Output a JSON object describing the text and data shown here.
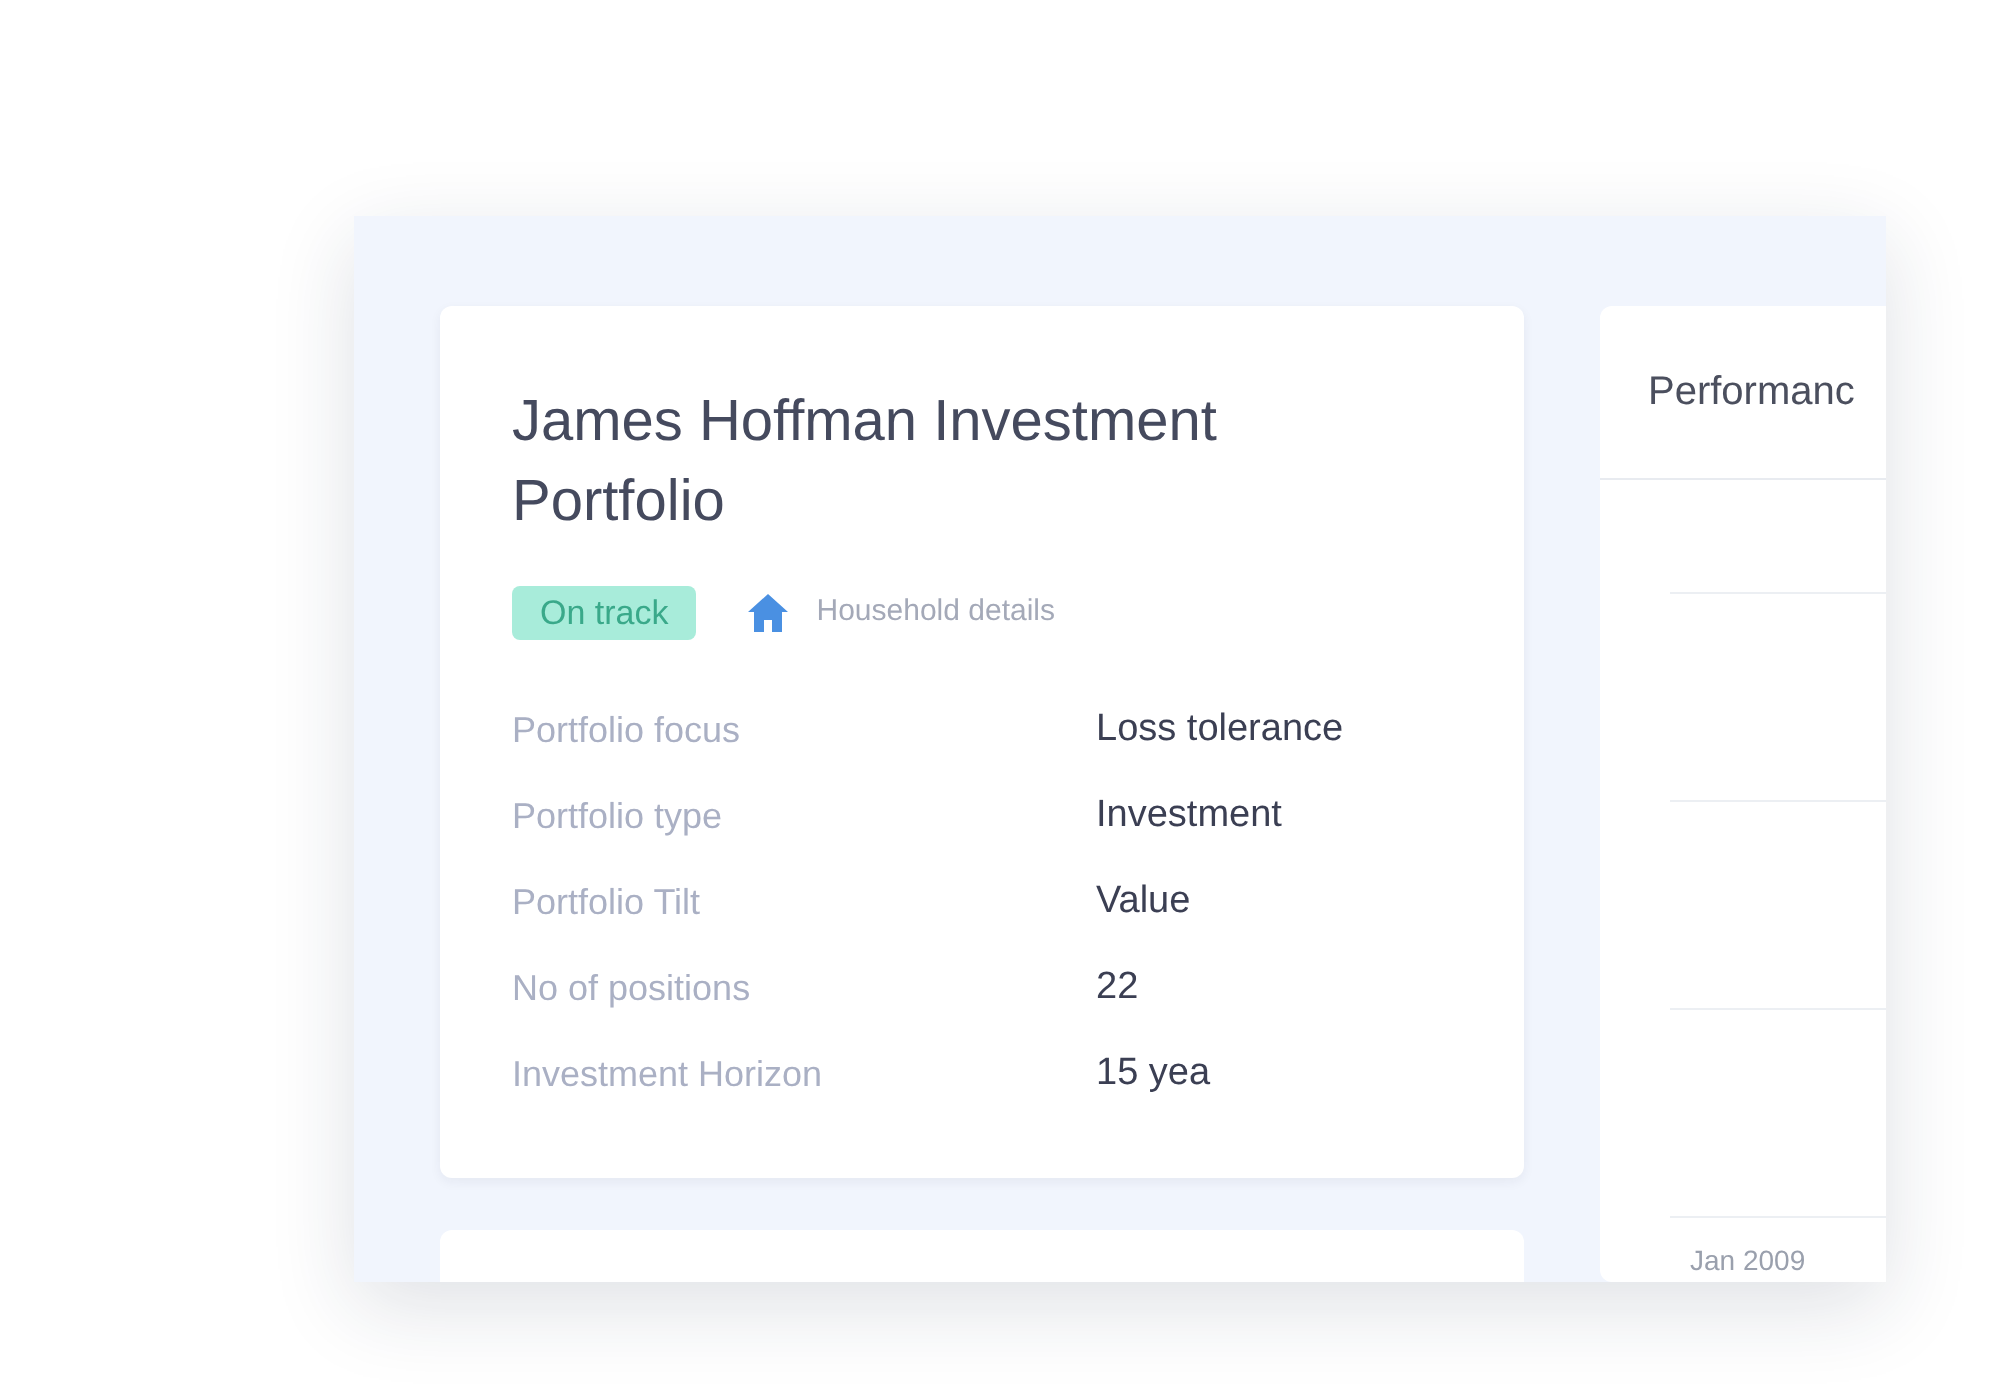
{
  "portfolio_card": {
    "title": "James Hoffman Investment Portfolio",
    "status": "On track",
    "household_link": "Household details",
    "details": [
      {
        "label": "Portfolio focus",
        "value": "Loss tolerance"
      },
      {
        "label": "Portfolio type",
        "value": "Investment"
      },
      {
        "label": "Portfolio Tilt",
        "value": "Value"
      },
      {
        "label": "No of positions",
        "value": "22"
      },
      {
        "label": "Investment Horizon",
        "value": "15 yea"
      }
    ]
  },
  "performance_card": {
    "title": "Performanc",
    "x_axis_labels": [
      "Jan 2009"
    ]
  }
}
